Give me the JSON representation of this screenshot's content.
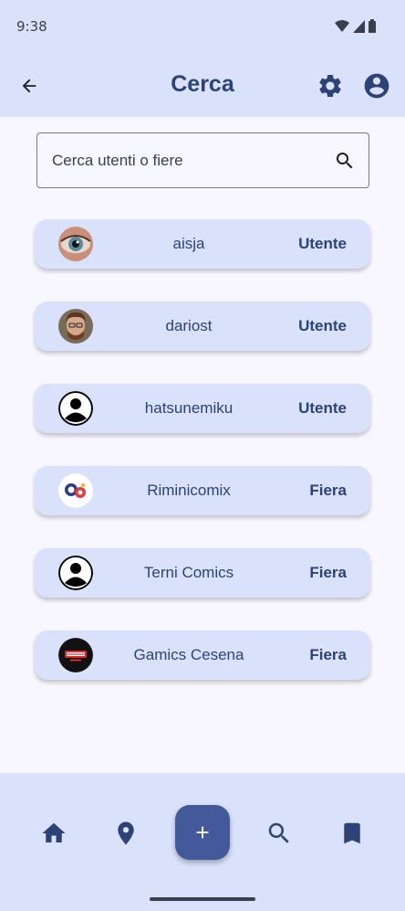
{
  "status_bar": {
    "time": "9:38"
  },
  "app_bar": {
    "title": "Cerca"
  },
  "search": {
    "placeholder": "Cerca utenti o fiere"
  },
  "results": [
    {
      "name": "aisja",
      "type": "Utente",
      "avatar": "eye-photo"
    },
    {
      "name": "dariost",
      "type": "Utente",
      "avatar": "person-photo"
    },
    {
      "name": "hatsunemiku",
      "type": "Utente",
      "avatar": "default-account-icon"
    },
    {
      "name": "Riminicomix",
      "type": "Fiera",
      "avatar": "riminicomix-logo"
    },
    {
      "name": "Terni Comics",
      "type": "Fiera",
      "avatar": "default-account-icon"
    },
    {
      "name": "Gamics Cesena",
      "type": "Fiera",
      "avatar": "gamics-logo"
    }
  ],
  "bottom_nav": {
    "items": [
      "home-icon",
      "location-icon",
      "add-icon",
      "search-icon",
      "bookmark-icon"
    ]
  },
  "colors": {
    "surface": "#d9e1fb",
    "background": "#f8f7ff",
    "primary": "#2d4376",
    "fab": "#44599a"
  }
}
